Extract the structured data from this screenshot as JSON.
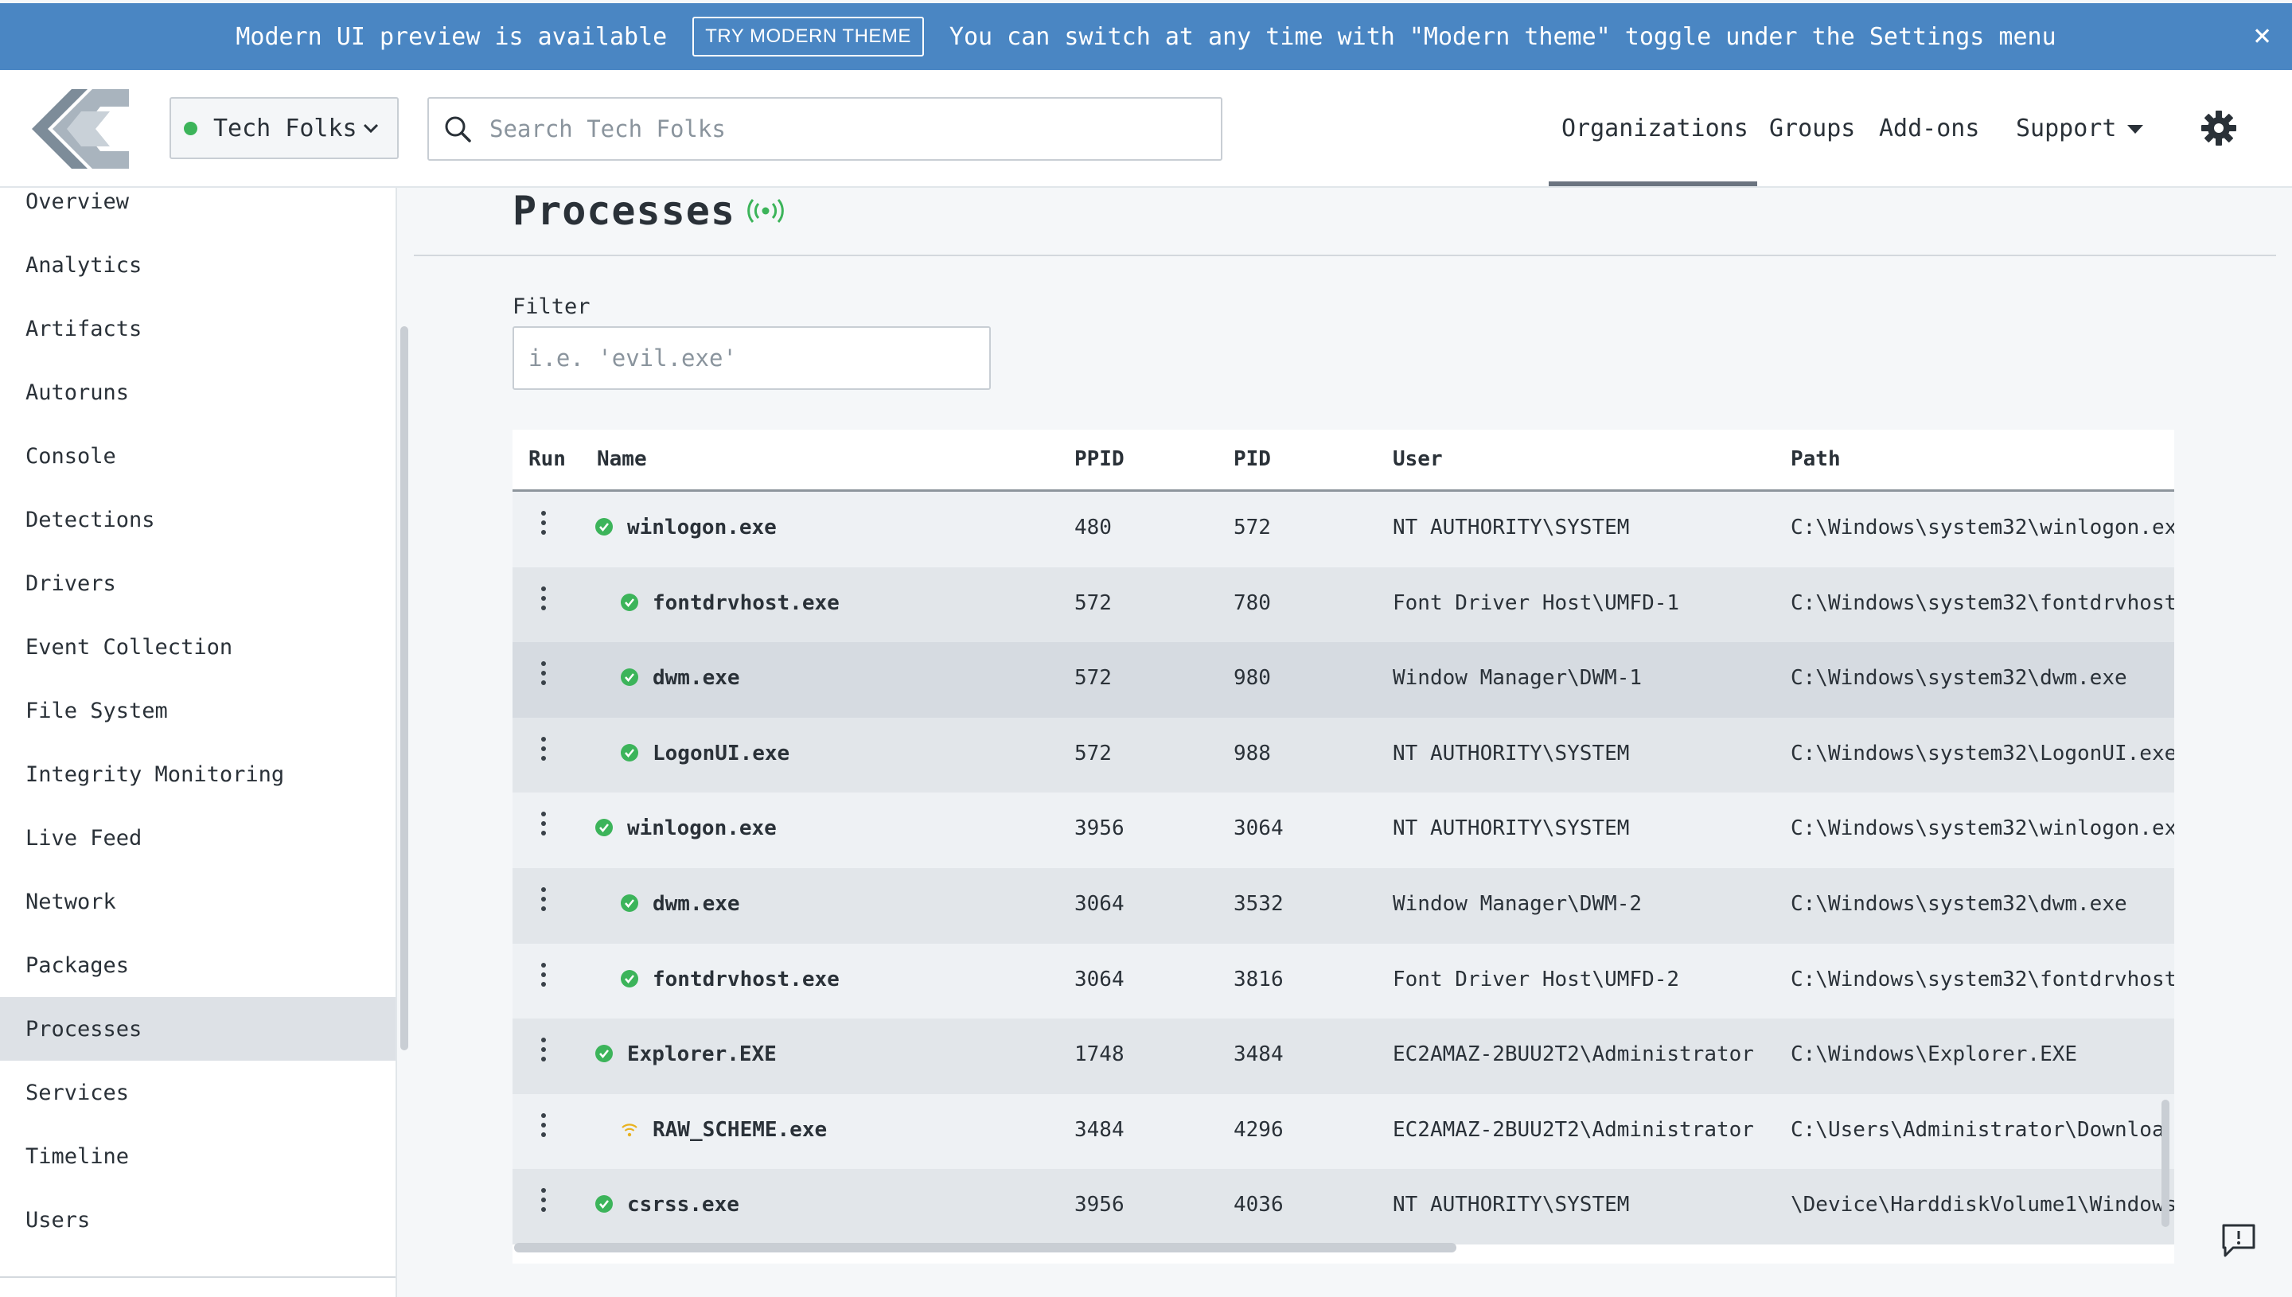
{
  "banner": {
    "message_left": "Modern UI preview is available",
    "button_label": "TRY MODERN THEME",
    "message_right": "You can switch at any time with \"Modern theme\" toggle under the Settings menu",
    "close_label": "×"
  },
  "header": {
    "org_name": "Tech Folks",
    "search_placeholder": "Search Tech Folks",
    "nav": {
      "organizations": "Organizations",
      "groups": "Groups",
      "addons": "Add-ons",
      "support": "Support"
    }
  },
  "sidebar": {
    "items": [
      "Overview",
      "Analytics",
      "Artifacts",
      "Autoruns",
      "Console",
      "Detections",
      "Drivers",
      "Event Collection",
      "File System",
      "Integrity Monitoring",
      "Live Feed",
      "Network",
      "Packages",
      "Processes",
      "Services",
      "Timeline",
      "Users"
    ],
    "active": "Processes"
  },
  "main": {
    "title": "Processes",
    "filter_label": "Filter",
    "filter_placeholder": "i.e. 'evil.exe'"
  },
  "table": {
    "columns": {
      "run": "Run",
      "name": "Name",
      "ppid": "PPID",
      "pid": "PID",
      "user": "User",
      "path": "Path"
    },
    "rows": [
      {
        "name": "winlogon.exe",
        "indent": 0,
        "status": "ok",
        "ppid": "480",
        "pid": "572",
        "user": "NT AUTHORITY\\SYSTEM",
        "path": "C:\\Windows\\system32\\winlogon.ex"
      },
      {
        "name": "fontdrvhost.exe",
        "indent": 1,
        "status": "ok",
        "ppid": "572",
        "pid": "780",
        "user": "Font Driver Host\\UMFD-1",
        "path": "C:\\Windows\\system32\\fontdrvhost"
      },
      {
        "name": "dwm.exe",
        "indent": 1,
        "status": "ok",
        "ppid": "572",
        "pid": "980",
        "user": "Window Manager\\DWM-1",
        "path": "C:\\Windows\\system32\\dwm.exe"
      },
      {
        "name": "LogonUI.exe",
        "indent": 1,
        "status": "ok",
        "ppid": "572",
        "pid": "988",
        "user": "NT AUTHORITY\\SYSTEM",
        "path": "C:\\Windows\\system32\\LogonUI.exe"
      },
      {
        "name": "winlogon.exe",
        "indent": 0,
        "status": "ok",
        "ppid": "3956",
        "pid": "3064",
        "user": "NT AUTHORITY\\SYSTEM",
        "path": "C:\\Windows\\system32\\winlogon.ex"
      },
      {
        "name": "dwm.exe",
        "indent": 1,
        "status": "ok",
        "ppid": "3064",
        "pid": "3532",
        "user": "Window Manager\\DWM-2",
        "path": "C:\\Windows\\system32\\dwm.exe"
      },
      {
        "name": "fontdrvhost.exe",
        "indent": 1,
        "status": "ok",
        "ppid": "3064",
        "pid": "3816",
        "user": "Font Driver Host\\UMFD-2",
        "path": "C:\\Windows\\system32\\fontdrvhost"
      },
      {
        "name": "Explorer.EXE",
        "indent": 0,
        "status": "ok",
        "ppid": "1748",
        "pid": "3484",
        "user": "EC2AMAZ-2BUU2T2\\Administrator",
        "path": "C:\\Windows\\Explorer.EXE"
      },
      {
        "name": "RAW_SCHEME.exe",
        "indent": 1,
        "status": "signal",
        "ppid": "3484",
        "pid": "4296",
        "user": "EC2AMAZ-2BUU2T2\\Administrator",
        "path": "C:\\Users\\Administrator\\Downloa"
      },
      {
        "name": "csrss.exe",
        "indent": 0,
        "status": "ok",
        "ppid": "3956",
        "pid": "4036",
        "user": "NT AUTHORITY\\SYSTEM",
        "path": "\\Device\\HarddiskVolume1\\Windows"
      }
    ]
  },
  "colors": {
    "banner": "#4a86c3",
    "status_ok": "#3cb45a",
    "status_signal": "#e8b21f",
    "live_icon": "#3cb45a"
  },
  "icons": {
    "logo": "logo-icon",
    "search": "search-icon",
    "gear": "gear-icon",
    "kebab": "kebab-menu-icon",
    "live": "live-signal-icon",
    "feedback": "feedback-icon"
  }
}
